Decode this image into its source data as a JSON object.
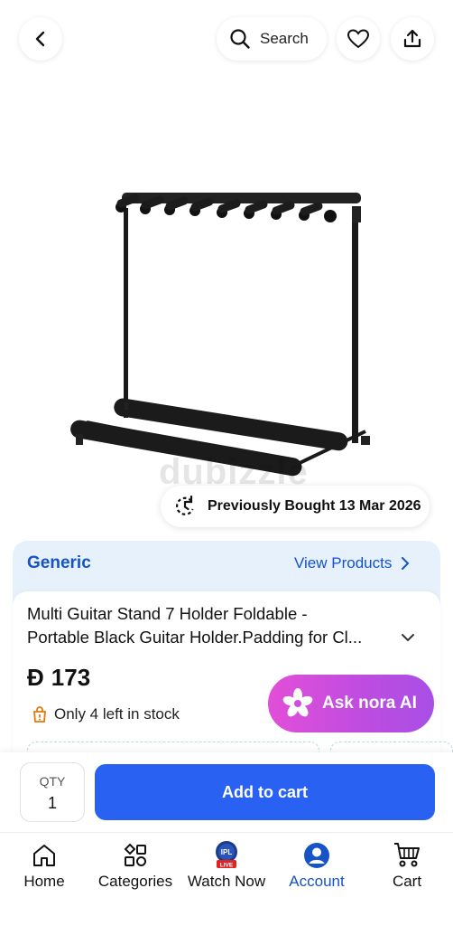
{
  "header": {
    "search_label": "Search"
  },
  "product": {
    "watermark": "dubizzle",
    "previously_bought": "Previously Bought 13 Mar 2026",
    "brand": "Generic",
    "view_products": "View Products",
    "title_line1": "Multi Guitar Stand 7 Holder Foldable -",
    "title_line2": "Portable Black Guitar Holder.Padding for Cl...",
    "currency_symbol": "Đ",
    "price": "173",
    "stock_text": "Only 4 left in stock",
    "ask_nora": "Ask nora AI"
  },
  "cart_bar": {
    "qty_label": "QTY",
    "qty_value": "1",
    "add_to_cart": "Add to cart"
  },
  "tabs": [
    {
      "label": "Home",
      "icon": "home-icon"
    },
    {
      "label": "Categories",
      "icon": "categories-icon"
    },
    {
      "label": "Watch Now",
      "icon": "ipl-live-icon",
      "badge": "LIVE",
      "logo_text": "IPL"
    },
    {
      "label": "Account",
      "icon": "account-icon",
      "active": true
    },
    {
      "label": "Cart",
      "icon": "cart-icon"
    }
  ],
  "colors": {
    "brand_blue": "#1553c7",
    "cta_blue": "#2962f2",
    "nora_gradient_start": "#e24fd8",
    "nora_gradient_end": "#a84fe6",
    "brand_card_bg": "#e7f1fb",
    "stock_warning": "#e07a10"
  }
}
